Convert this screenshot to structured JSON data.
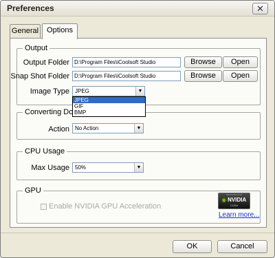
{
  "window": {
    "title": "Preferences",
    "close_symbol": "✕"
  },
  "tabs": [
    {
      "label": "General"
    },
    {
      "label": "Options"
    }
  ],
  "output": {
    "legend": "Output",
    "output_folder": {
      "label": "Output Folder",
      "value": "D:\\Program Files\\iCoolsoft Studio",
      "browse": "Browse",
      "open": "Open"
    },
    "snapshot_folder": {
      "label": "Snap Shot Folder",
      "value": "D:\\Program Files\\iCoolsoft Studio",
      "browse": "Browse",
      "open": "Open"
    },
    "image_type": {
      "label": "Image Type",
      "value": "JPEG",
      "options": [
        "JPEG",
        "GIF",
        "BMP"
      ]
    }
  },
  "converting": {
    "legend": "Converting Don",
    "action": {
      "label": "Action",
      "value": "No Action"
    }
  },
  "cpu": {
    "legend": "CPU Usage",
    "max_usage": {
      "label": "Max Usage",
      "value": "50%"
    }
  },
  "gpu": {
    "legend": "GPU",
    "checkbox_label": "Enable NVIDIA GPU Acceleration",
    "badge_top": "DESIGNED FOR",
    "badge_brand": "NVIDIA",
    "badge_bottom": "CUDA",
    "learn_more": "Learn more..."
  },
  "footer": {
    "ok": "OK",
    "cancel": "Cancel"
  },
  "colors": {
    "selection": "#316ac5",
    "link": "#1a33cc",
    "nvidia_green": "#76b900"
  }
}
